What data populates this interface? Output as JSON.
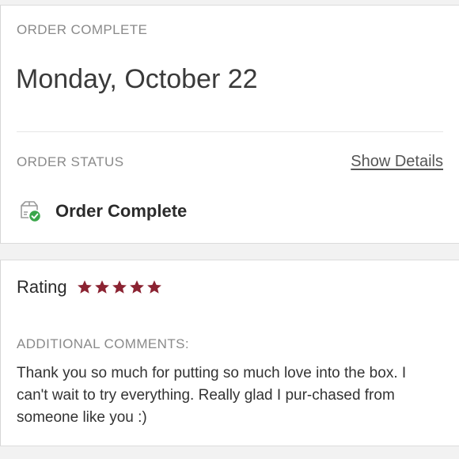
{
  "order": {
    "section_label": "ORDER COMPLETE",
    "date": "Monday, October 22"
  },
  "status": {
    "section_label": "ORDER STATUS",
    "show_details_label": "Show Details",
    "value": "Order Complete",
    "icon": "box-check-icon",
    "check_color": "#3aa64a"
  },
  "review": {
    "rating_label": "Rating",
    "rating": 5,
    "rating_max": 5,
    "star_color": "#8b2332",
    "comments_label": "ADDITIONAL COMMENTS:",
    "comments_text": "Thank you so much for putting so much love into the box. I can't wait to try everything. Really glad I pur-chased from someone like you :)"
  }
}
